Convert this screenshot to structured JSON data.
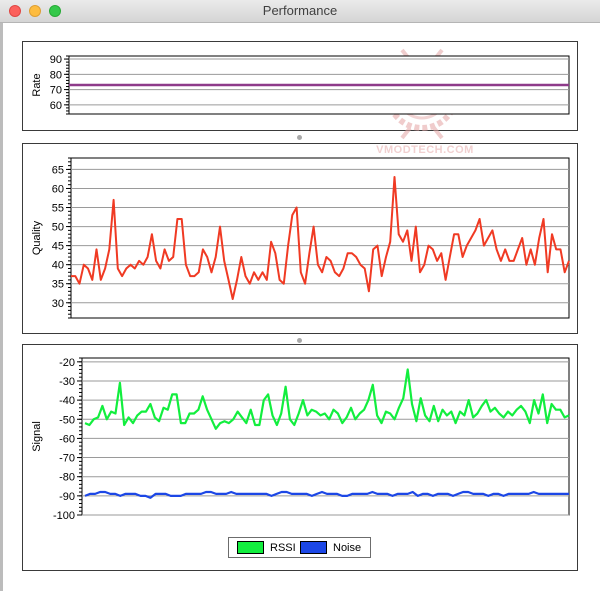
{
  "window": {
    "title": "Performance"
  },
  "watermark": {
    "text": "VMODTECH.COM"
  },
  "colors": {
    "rate": "#8e3a8a",
    "quality": "#f03a23",
    "rssi": "#12ee3e",
    "noise": "#1c47e6"
  },
  "rate_chart": {
    "ylabel": "Rate",
    "ylim": [
      54,
      92
    ],
    "ticks": [
      "90",
      "80",
      "70",
      "60"
    ],
    "value": 73
  },
  "quality_chart": {
    "ylabel": "Quality",
    "ylim": [
      26,
      68
    ],
    "ticks": [
      "65",
      "60",
      "55",
      "50",
      "45",
      "40",
      "35",
      "30"
    ],
    "values": [
      37,
      37,
      35,
      40,
      39,
      36,
      44,
      36,
      39,
      44,
      57,
      39,
      37,
      39,
      40,
      39,
      41,
      40,
      42,
      48,
      41,
      39,
      44,
      41,
      42,
      52,
      52,
      40,
      37,
      37,
      38,
      44,
      42,
      38,
      42,
      50,
      41,
      36,
      31,
      36,
      42,
      37,
      35,
      38,
      36,
      38,
      36,
      46,
      43,
      36,
      35,
      45,
      53,
      55,
      38,
      35,
      43,
      50,
      40,
      38,
      42,
      41,
      38,
      37,
      39,
      43,
      43,
      42,
      40,
      39,
      33,
      44,
      45,
      37,
      42,
      46,
      63,
      48,
      46,
      49,
      41,
      50,
      38,
      40,
      45,
      44,
      41,
      43,
      36,
      42,
      48,
      48,
      42,
      45,
      47,
      49,
      52,
      45,
      47,
      49,
      44,
      41,
      44,
      41,
      41,
      44,
      47,
      40,
      44,
      40,
      47,
      52,
      38,
      48,
      44,
      44,
      38,
      41
    ]
  },
  "signal_chart": {
    "ylabel": "Signal",
    "ylim": [
      -100,
      -18
    ],
    "ticks": [
      "-20",
      "-30",
      "-40",
      "-50",
      "-60",
      "-70",
      "-80",
      "-90",
      "-100"
    ],
    "series": [
      {
        "name": "RSSI",
        "values": [
          -52,
          -53,
          -50,
          -49,
          -43,
          -50,
          -46,
          -47,
          -31,
          -53,
          -49,
          -52,
          -48,
          -46,
          -46,
          -42,
          -49,
          -51,
          -44,
          -45,
          -37,
          -37,
          -52,
          -52,
          -47,
          -47,
          -45,
          -38,
          -45,
          -50,
          -55,
          -52,
          -51,
          -52,
          -50,
          -46,
          -49,
          -52,
          -45,
          -53,
          -53,
          -40,
          -37,
          -48,
          -53,
          -47,
          -33,
          -50,
          -53,
          -47,
          -40,
          -48,
          -45,
          -46,
          -48,
          -47,
          -50,
          -45,
          -47,
          -52,
          -49,
          -44,
          -50,
          -47,
          -45,
          -40,
          -32,
          -48,
          -52,
          -46,
          -47,
          -50,
          -44,
          -39,
          -24,
          -42,
          -51,
          -39,
          -48,
          -51,
          -43,
          -51,
          -45,
          -48,
          -46,
          -52,
          -46,
          -48,
          -40,
          -49,
          -47,
          -43,
          -40,
          -46,
          -44,
          -47,
          -49,
          -46,
          -48,
          -45,
          -43,
          -46,
          -52,
          -40,
          -47,
          -37,
          -52,
          -42,
          -45,
          -45,
          -49,
          -48
        ]
      },
      {
        "name": "Noise",
        "values": [
          -90,
          -89,
          -89,
          -88,
          -88,
          -89,
          -89,
          -90,
          -89,
          -89,
          -89,
          -90,
          -90,
          -91,
          -89,
          -89,
          -89,
          -90,
          -90,
          -90,
          -89,
          -89,
          -89,
          -89,
          -88,
          -88,
          -89,
          -89,
          -89,
          -88,
          -89,
          -89,
          -89,
          -89,
          -89,
          -89,
          -89,
          -90,
          -89,
          -88,
          -88,
          -89,
          -89,
          -89,
          -89,
          -90,
          -89,
          -88,
          -89,
          -89,
          -89,
          -90,
          -90,
          -89,
          -89,
          -89,
          -89,
          -88,
          -89,
          -89,
          -89,
          -90,
          -89,
          -89,
          -89,
          -88,
          -90,
          -89,
          -89,
          -90,
          -89,
          -89,
          -89,
          -90,
          -89,
          -88,
          -88,
          -89,
          -89,
          -89,
          -90,
          -89,
          -89,
          -90,
          -89,
          -89,
          -89,
          -89,
          -89,
          -88,
          -89,
          -89,
          -89,
          -89,
          -89,
          -89,
          -89
        ]
      }
    ]
  },
  "legend": {
    "rssi_label": "RSSI",
    "noise_label": "Noise"
  }
}
